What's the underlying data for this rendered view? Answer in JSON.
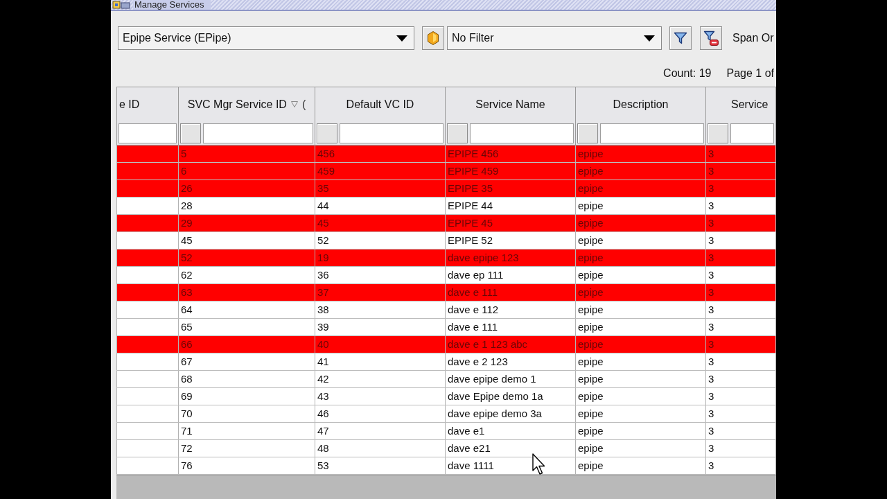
{
  "window": {
    "title": "Manage Services"
  },
  "toolbar": {
    "service_type": "Epipe Service (EPipe)",
    "filter": "No Filter",
    "span_label": "Span Or"
  },
  "status": {
    "count": "Count: 19",
    "page": "Page 1 of"
  },
  "table": {
    "columns": [
      {
        "label": "e ID",
        "sorted": false
      },
      {
        "label": "SVC Mgr Service ID",
        "sorted": true,
        "sort_rank": "("
      },
      {
        "label": "Default VC ID",
        "sorted": false
      },
      {
        "label": "Service Name",
        "sorted": false
      },
      {
        "label": "Description",
        "sorted": false
      },
      {
        "label": "Service",
        "sorted": false
      }
    ],
    "rows": [
      {
        "cells": [
          "5",
          "456",
          "EPIPE 456",
          "epipe",
          "3"
        ],
        "color": "#ff0000"
      },
      {
        "cells": [
          "6",
          "459",
          "EPIPE 459",
          "epipe",
          "3"
        ],
        "color": "#ff0000"
      },
      {
        "cells": [
          "26",
          "35",
          "EPIPE 35",
          "epipe",
          "3"
        ],
        "color": "#ff0000"
      },
      {
        "cells": [
          "28",
          "44",
          "EPIPE 44",
          "epipe",
          "3"
        ],
        "color": "#ffffff"
      },
      {
        "cells": [
          "29",
          "45",
          "EPIPE 45",
          "epipe",
          "3"
        ],
        "color": "#ff0000"
      },
      {
        "cells": [
          "45",
          "52",
          "EPIPE 52",
          "epipe",
          "3"
        ],
        "color": "#ffffff"
      },
      {
        "cells": [
          "52",
          "19",
          "dave epipe 123",
          "epipe",
          "3"
        ],
        "color": "#ff0000"
      },
      {
        "cells": [
          "62",
          "36",
          "dave ep 111",
          "epipe",
          "3"
        ],
        "color": "#ffffff"
      },
      {
        "cells": [
          "63",
          "37",
          "dave e 111",
          "epipe",
          "3"
        ],
        "color": "#ff0000"
      },
      {
        "cells": [
          "64",
          "38",
          "dave e 112",
          "epipe",
          "3"
        ],
        "color": "#ffffff"
      },
      {
        "cells": [
          "65",
          "39",
          "dave e 111",
          "epipe",
          "3"
        ],
        "color": "#ffffff"
      },
      {
        "cells": [
          "66",
          "40",
          "dave e 1 123 abc",
          "epipe",
          "3"
        ],
        "color": "#ff0000"
      },
      {
        "cells": [
          "67",
          "41",
          "dave e 2 123",
          "epipe",
          "3"
        ],
        "color": "#ffffff"
      },
      {
        "cells": [
          "68",
          "42",
          "dave epipe demo 1",
          "epipe",
          "3"
        ],
        "color": "#ffffff"
      },
      {
        "cells": [
          "69",
          "43",
          "dave Epipe demo 1a",
          "epipe",
          "3"
        ],
        "color": "#ffffff"
      },
      {
        "cells": [
          "70",
          "46",
          "dave epipe demo 3a",
          "epipe",
          "3"
        ],
        "color": "#ffffff"
      },
      {
        "cells": [
          "71",
          "47",
          "dave e1",
          "epipe",
          "3"
        ],
        "color": "#ffffff"
      },
      {
        "cells": [
          "72",
          "48",
          "dave e21",
          "epipe",
          "3"
        ],
        "color": "#ffffff"
      },
      {
        "cells": [
          "76",
          "53",
          "dave 1111",
          "epipe",
          "3"
        ],
        "color": "#ffffff"
      }
    ]
  }
}
